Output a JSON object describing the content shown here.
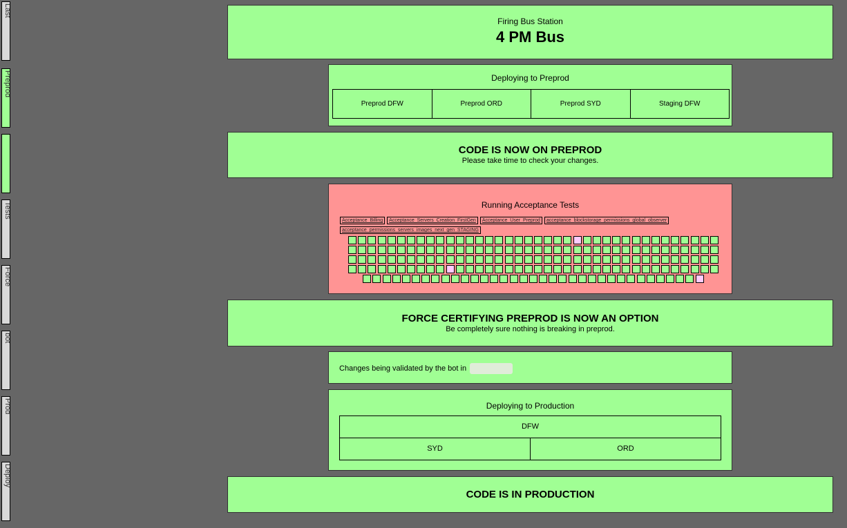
{
  "sidebar": {
    "tabs": [
      {
        "label": "Last",
        "state": "default"
      },
      {
        "label": "Preprod",
        "state": "green"
      },
      {
        "label": "",
        "state": "green"
      },
      {
        "label": "Tests",
        "state": "default"
      },
      {
        "label": "Force",
        "state": "default"
      },
      {
        "label": "bot",
        "state": "default"
      },
      {
        "label": "Prod",
        "state": "default"
      },
      {
        "label": "Deploy",
        "state": "default"
      }
    ]
  },
  "bus_station": {
    "title": "Firing Bus Station",
    "bus_name": "4 PM Bus"
  },
  "deploy_preprod": {
    "title": "Deploying to Preprod",
    "regions": [
      "Preprod DFW",
      "Preprod ORD",
      "Preprod SYD",
      "Staging DFW"
    ]
  },
  "code_preprod": {
    "headline": "CODE IS NOW ON PREPROD",
    "subline": "Please take time to check your changes."
  },
  "acceptance": {
    "title": "Running Acceptance Tests",
    "failed_tests": [
      "Acceptance_Billing",
      "Acceptance_Servers_Creation_FirstGen",
      "Acceptance_User_Preprod",
      "acceptance_blockstorage_permissions_global_observer",
      "acceptance_permissions_servers_images_next_gen_STAGING"
    ],
    "grid": {
      "columns": 38,
      "rows": [
        38,
        38,
        38,
        38,
        35
      ],
      "pending_cells": [
        [
          0,
          23
        ],
        [
          3,
          10
        ],
        [
          4,
          34
        ]
      ]
    }
  },
  "force_certify": {
    "headline": "FORCE CERTIFYING PREPROD IS NOW AN OPTION",
    "subline": "Be completely sure nothing is breaking in preprod."
  },
  "bot_validation": {
    "text": "Changes being validated by the bot in"
  },
  "deploy_prod": {
    "title": "Deploying to Production",
    "regions": {
      "dfw": "DFW",
      "syd": "SYD",
      "ord": "ORD"
    }
  },
  "code_prod": {
    "headline": "CODE IS IN PRODUCTION"
  },
  "colors": {
    "background": "#666666",
    "success": "#a0ff94",
    "failure": "#ff9494",
    "pending": "#ffccff",
    "tab_default": "#d9d9d9"
  }
}
